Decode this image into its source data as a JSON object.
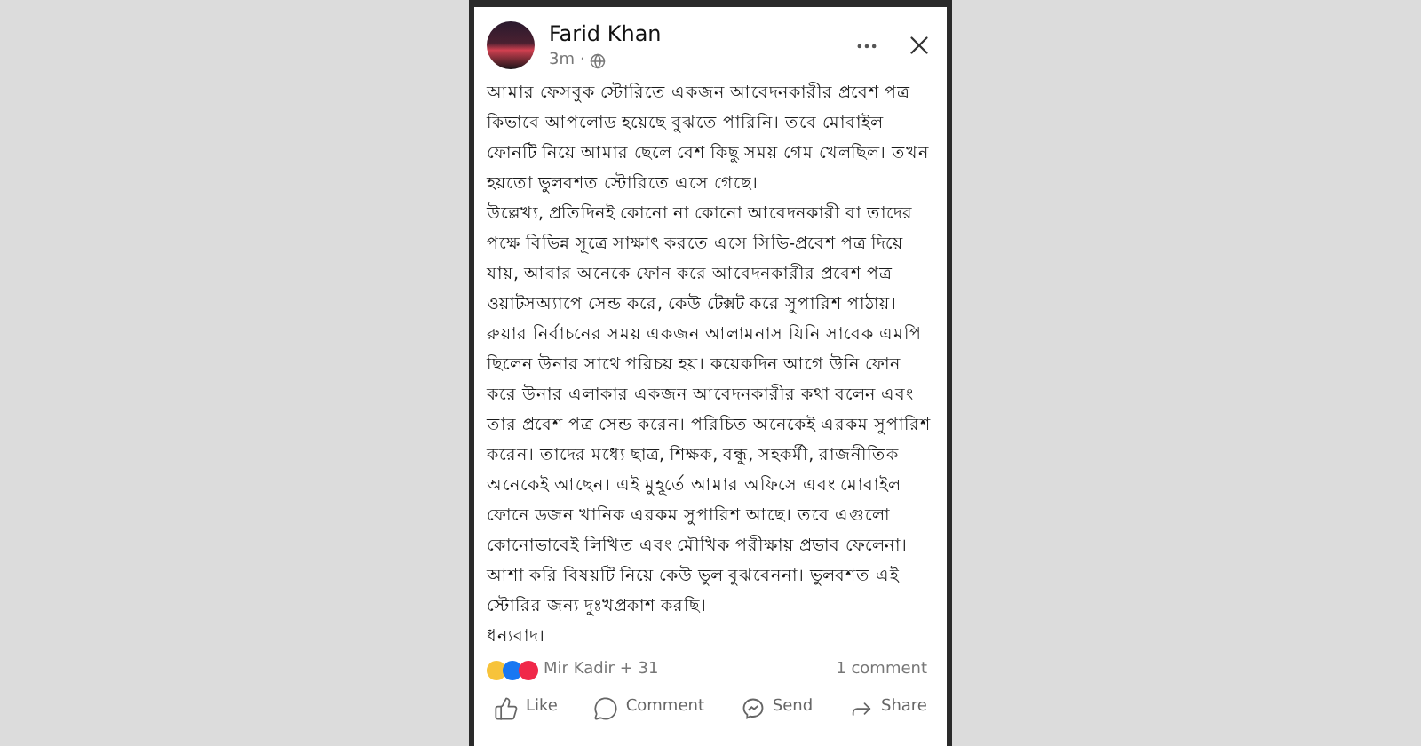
{
  "post": {
    "author": "Farid Khan",
    "time": "3m",
    "separator": "·",
    "paragraphs": [
      "আমার ফেসবুক স্টোরিতে একজন আবেদনকারীর প্রবেশ পত্র কিভাবে আপলোড হয়েছে বুঝতে পারিনি। তবে মোবাইল ফোনটি নিয়ে আমার ছেলে বেশ কিছু সময় গেম খেলছিল। তখন হয়তো ভুলবশত স্টোরিতে এসে গেছে।",
      "উল্লেখ্য, প্রতিদিনই কোনো না কোনো আবেদনকারী বা তাদের পক্ষে বিভিন্ন সূত্রে সাক্ষাৎ করতে এসে সিভি-প্রবেশ পত্র দিয়ে যায়, আবার অনেকে ফোন করে আবেদনকারীর প্রবেশ পত্র ওয়াটসঅ্যাপে সেন্ড করে, কেউ টেক্সট করে সুপারিশ পাঠায়। রুয়ার নির্বাচনের সময় একজন আলামনাস যিনি সাবেক এমপি ছিলেন উনার সাথে পরিচয় হয়। কয়েকদিন আগে উনি ফোন করে উনার এলাকার একজন আবেদনকারীর কথা বলেন এবং তার প্রবেশ পত্র সেন্ড করেন। পরিচিত অনেকেই এরকম সুপারিশ করেন। তাদের মধ্যে ছাত্র, শিক্ষক, বন্ধু, সহকর্মী, রাজনীতিক অনেকেই আছেন। এই মুহূর্তে আমার অফিসে এবং মোবাইল ফোনে ডজন খানিক এরকম সুপারিশ আছে। তবে এগুলো কোনোভাবেই লিখিত এবং মৌখিক পরীক্ষায় প্রভাব ফেলেনা।",
      "আশা করি বিষয়টি নিয়ে কেউ ভুল বুঝবেননা। ভুলবশত এই স্টোরির জন্য দুঃখপ্রকাশ করছি।",
      "ধন্যবাদ।"
    ],
    "reactions": "Mir Kadir + 31",
    "comments": "1 comment",
    "actions": [
      {
        "kind": "like",
        "label": "Like"
      },
      {
        "kind": "comment",
        "label": "Comment"
      },
      {
        "kind": "send",
        "label": "Send"
      },
      {
        "kind": "share",
        "label": "Share"
      }
    ]
  }
}
